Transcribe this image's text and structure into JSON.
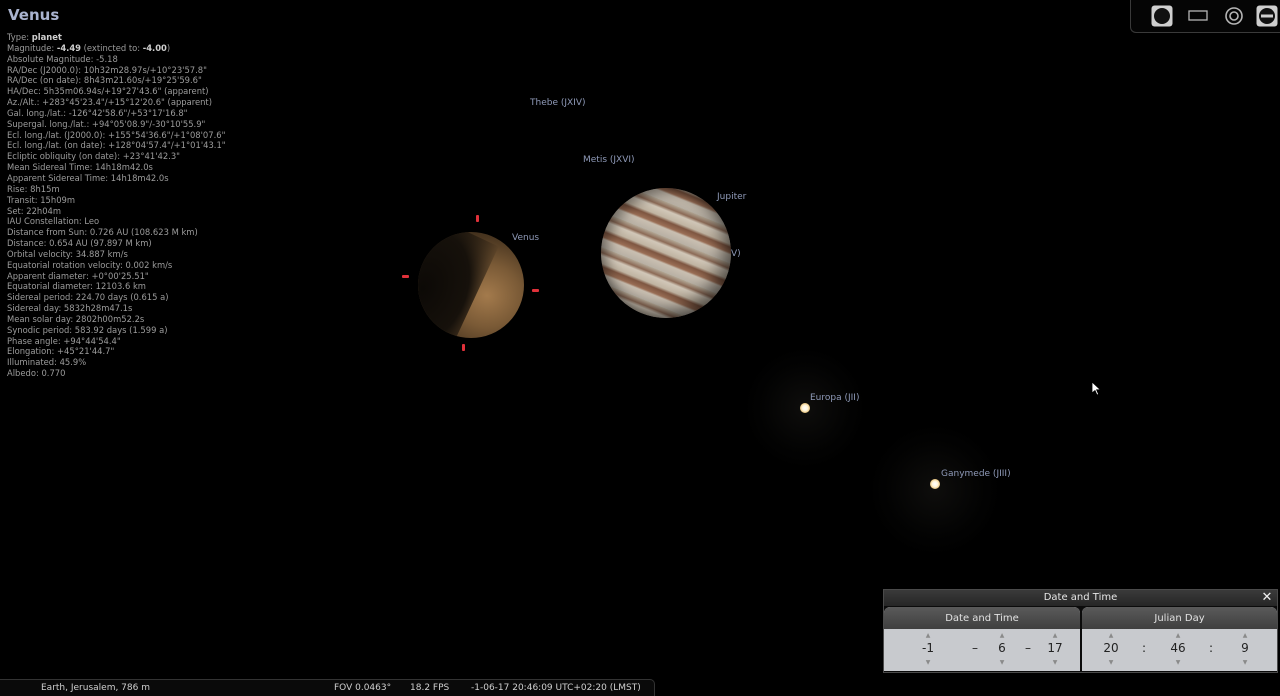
{
  "object": {
    "name": "Venus",
    "info": [
      {
        "label": "Type: ",
        "value": "planet",
        "emph": true
      },
      {
        "label": "Magnitude: ",
        "value": "-4.49",
        "emph": true,
        "suffix": " (extincted to: ",
        "value2": "-4.00",
        "suffix2": ")"
      },
      {
        "label": "Absolute Magnitude: -5.18"
      },
      {
        "label": "RA/Dec (J2000.0): 10h32m28.97s/+10°23'57.8\""
      },
      {
        "label": "RA/Dec (on date): 8h43m21.60s/+19°25'59.6\""
      },
      {
        "label": "HA/Dec: 5h35m06.94s/+19°27'43.6\" (apparent)"
      },
      {
        "label": "Az./Alt.: +283°45'23.4\"/+15°12'20.6\" (apparent)"
      },
      {
        "label": "Gal. long./lat.: -126°42'58.6\"/+53°17'16.8\""
      },
      {
        "label": "Supergal. long./lat.: +94°05'08.9\"/-30°10'55.9\""
      },
      {
        "label": "Ecl. long./lat. (J2000.0): +155°54'36.6\"/+1°08'07.6\""
      },
      {
        "label": "Ecl. long./lat. (on date): +128°04'57.4\"/+1°01'43.1\""
      },
      {
        "label": "Ecliptic obliquity (on date): +23°41'42.3\""
      },
      {
        "label": "Mean Sidereal Time: 14h18m42.0s"
      },
      {
        "label": "Apparent Sidereal Time: 14h18m42.0s"
      },
      {
        "label": "Rise: 8h15m"
      },
      {
        "label": "Transit: 15h09m"
      },
      {
        "label": "Set: 22h04m"
      },
      {
        "label": "IAU Constellation: Leo"
      },
      {
        "label": "Distance from Sun: 0.726 AU (108.623 M km)"
      },
      {
        "label": "Distance: 0.654 AU (97.897 M km)"
      },
      {
        "label": "Orbital velocity: 34.887 km/s"
      },
      {
        "label": "Equatorial rotation velocity: 0.002 km/s"
      },
      {
        "label": "Apparent diameter: +0°00'25.51\""
      },
      {
        "label": "Equatorial diameter: 12103.6 km"
      },
      {
        "label": "Sidereal period: 224.70 days (0.615 a)"
      },
      {
        "label": "Sidereal day: 5832h28m47.1s"
      },
      {
        "label": "Mean solar day: 2802h00m52.2s"
      },
      {
        "label": "Synodic period: 583.92 days (1.599 a)"
      },
      {
        "label": "Phase angle: +94°44'54.4\""
      },
      {
        "label": "Elongation: +45°21'44.7\""
      },
      {
        "label": "Illuminated: 45.9%"
      },
      {
        "label": "Albedo: 0.770"
      }
    ]
  },
  "sky_labels": {
    "thebe": "Thebe (JXIV)",
    "metis": "Metis (JXVI)",
    "jupiter": "Jupiter",
    "venus": "Venus",
    "hidden_moon": "V)",
    "europa": "Europa (JII)",
    "ganymede": "Ganymede (JIII)"
  },
  "toolbar": {
    "icons": [
      "planet-disk-icon",
      "rectangle-icon",
      "target-icon",
      "no-entry-icon"
    ]
  },
  "status_bar": {
    "location": "Earth, Jerusalem, 786 m",
    "fov": "FOV 0.0463°",
    "fps": "18.2 FPS",
    "datetime": "-1-06-17 20:46:09 UTC+02:20 (LMST)"
  },
  "date_time_dialog": {
    "title": "Date and Time",
    "close": "✕",
    "date_tab": "Date and Time",
    "jd_tab": "Julian Day",
    "year": "-1",
    "month": "6",
    "day": "17",
    "hour": "20",
    "minute": "46",
    "second": "9",
    "date_sep": "–",
    "time_sep": ":",
    "arrow_up": "▲",
    "arrow_down": "▼"
  },
  "colors": {
    "marker": "#e0313a",
    "label": "#8f9ab8",
    "title": "#a9b3cf"
  }
}
